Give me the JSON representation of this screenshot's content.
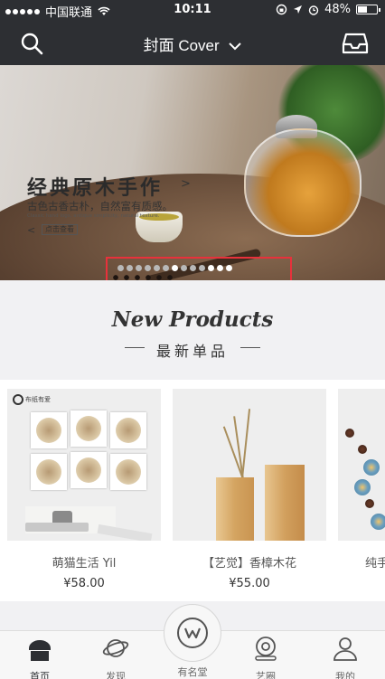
{
  "status_bar": {
    "carrier": "中国联通",
    "time": "10:11",
    "battery_percent": "48%",
    "battery_level": 0.48
  },
  "nav": {
    "title": "封面 Cover",
    "left_icon": "search-icon",
    "right_icon": "inbox-icon"
  },
  "banner": {
    "headline": "经典原木手作",
    "subtitle": "古色古香古朴，自然富有质感。",
    "tiny_caption": "Classic hand logs, antique simplicity, natural texture.",
    "button_label": "点击查看",
    "dot_count": 13,
    "active_dot": 6
  },
  "section": {
    "title": "New Products",
    "subtitle": "最新单品"
  },
  "products": [
    {
      "name": "萌猫生活 Yil",
      "price": "¥58.00",
      "logo_text": "布纸有爱"
    },
    {
      "name": "【艺觉】香樟木花",
      "price": "¥55.00"
    },
    {
      "name": "纯手",
      "price": ""
    }
  ],
  "tabbar": {
    "items": [
      {
        "label": "首页",
        "icon": "home-icon",
        "active": true
      },
      {
        "label": "发现",
        "icon": "planet-icon",
        "active": false
      },
      {
        "label": "有名堂",
        "icon": "w-logo-icon",
        "active": false
      },
      {
        "label": "艺圈",
        "icon": "at-icon",
        "active": false
      },
      {
        "label": "我的",
        "icon": "user-icon",
        "active": false
      }
    ]
  },
  "colors": {
    "header_bg": "#2d2f33",
    "highlight_box": "#e8313b",
    "page_bg": "#f1f1f3"
  }
}
